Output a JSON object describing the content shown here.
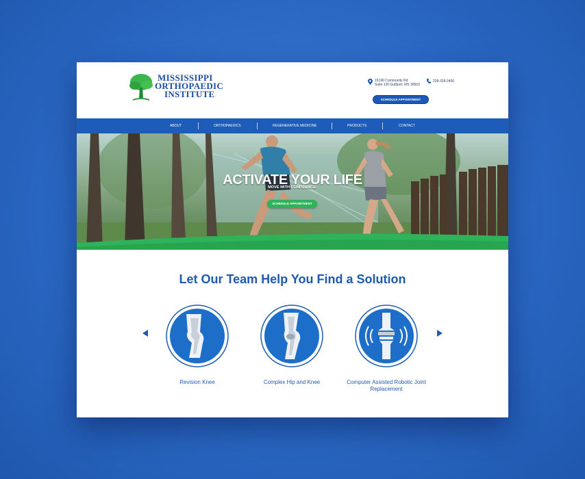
{
  "logo": {
    "line1": "MISSISSIPPI",
    "line2": "ORTHOPAEDIC",
    "line3": "INSTITUTE"
  },
  "contact": {
    "address_line1": "15190 Community Rd",
    "address_line2": "Suite 120 Gulfport, MS 39503",
    "phone": "228-328-2400",
    "schedule_label": "SCHEDULE APPOINTMENT"
  },
  "nav": {
    "items": [
      "ABOUT",
      "ORTHOPAEDICS",
      "REGENERATIVE MEDICINE",
      "PRODUCTS",
      "CONTACT"
    ]
  },
  "hero": {
    "title": "ACTIVATE YOUR LIFE",
    "subtitle": "MOVE WITH CONFIDENCE!",
    "button_label": "SCHEDULE APPOINTMENT"
  },
  "solutions": {
    "heading": "Let Our Team Help You Find a Solution",
    "cards": [
      {
        "label": "Revision Knee",
        "icon": "knee-icon"
      },
      {
        "label": "Complex Hip and Knee",
        "icon": "knee-side-icon"
      },
      {
        "label": "Computer Assisted Robotic Joint Replacement",
        "icon": "robotic-joint-icon"
      }
    ]
  },
  "colors": {
    "brand_blue": "#1d5cb8",
    "accent_green": "#2fb35a",
    "heading_blue": "#1d5ab0"
  }
}
